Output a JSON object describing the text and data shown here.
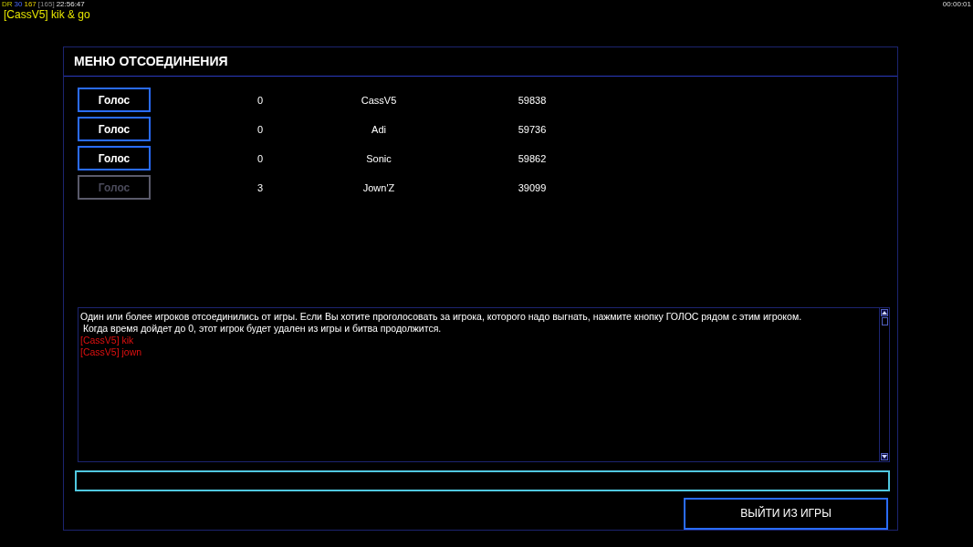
{
  "hud": {
    "stats": [
      {
        "text": "DR",
        "kind": "label"
      },
      {
        "text": "30",
        "kind": "ping"
      },
      {
        "text": "167",
        "kind": "fps"
      },
      {
        "text": "[165]",
        "kind": "dim"
      },
      {
        "text": "22:56:47",
        "kind": "time"
      }
    ],
    "clock": "00:00:01",
    "message": "[CassV5] kik & go"
  },
  "panel": {
    "title": "МЕНЮ ОТСОЕДИНЕНИЯ",
    "players": [
      {
        "vote_label": "Голос",
        "disabled": false,
        "votes": "0",
        "name": "CassV5",
        "score": "59838"
      },
      {
        "vote_label": "Голос",
        "disabled": false,
        "votes": "0",
        "name": "Adi",
        "score": "59736"
      },
      {
        "vote_label": "Голос",
        "disabled": false,
        "votes": "0",
        "name": "Sonic",
        "score": "59862"
      },
      {
        "vote_label": "Голос",
        "disabled": true,
        "votes": "3",
        "name": "Jown'Z",
        "score": "39099"
      }
    ],
    "log": [
      {
        "kind": "system",
        "text": "Один или более игроков отсоединились от игры. Если Вы хотите проголосовать за игрока, которого надо выгнать, нажмите кнопку ГОЛОС рядом с этим игроком."
      },
      {
        "kind": "system",
        "text": " Когда время дойдет до 0, этот игрок будет удален из игры и битва продолжится."
      },
      {
        "kind": "chat",
        "text": "[CassV5] kik"
      },
      {
        "kind": "chat",
        "text": "[CassV5] jown"
      }
    ],
    "exit_button": "ВЫЙТИ ИЗ ИГРЫ"
  }
}
